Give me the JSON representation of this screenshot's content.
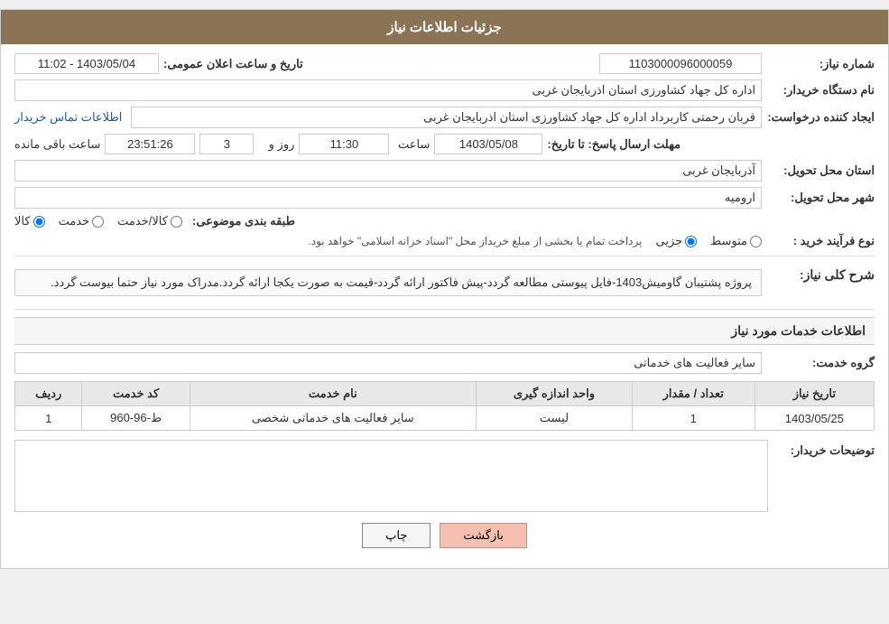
{
  "header": {
    "title": "جزئیات اطلاعات نیاز"
  },
  "fields": {
    "need_number_label": "شماره نیاز:",
    "need_number_value": "1103000096000059",
    "announce_datetime_label": "تاریخ و ساعت اعلان عمومی:",
    "announce_datetime_value": "1403/05/04 - 11:02",
    "buyer_org_label": "نام دستگاه خریدار:",
    "buyer_org_value": "اداره کل جهاد کشاورزی استان اذربایجان غربی",
    "creator_label": "ایجاد کننده درخواست:",
    "creator_value": "قربان  رحمتی  کاربرداد اداره کل جهاد کشاورزی استان اذربایجان غربی",
    "contact_info_link": "اطلاعات تماس خریدار",
    "reply_deadline_label": "مهلت ارسال پاسخ: تا تاریخ:",
    "reply_date_value": "1403/05/08",
    "reply_time_label": "ساعت",
    "reply_time_value": "11:30",
    "reply_days_label": "روز و",
    "reply_days_value": "3",
    "reply_remaining_label": "ساعت باقی مانده",
    "reply_remaining_value": "23:51:26",
    "delivery_province_label": "استان محل تحویل:",
    "delivery_province_value": "آذربایجان غربی",
    "delivery_city_label": "شهر محل تحویل:",
    "delivery_city_value": "ارومیه",
    "category_label": "طبقه بندی موضوعی:",
    "category_options": [
      {
        "label": "کالا",
        "value": "kala"
      },
      {
        "label": "خدمت",
        "value": "khedmat"
      },
      {
        "label": "کالا/خدمت",
        "value": "kala_khedmat"
      }
    ],
    "purchase_type_label": "نوع فرآیند خرید :",
    "purchase_type_options": [
      {
        "label": "جزیی",
        "value": "jozi"
      },
      {
        "label": "متوسط",
        "value": "motavaset"
      }
    ],
    "purchase_type_note": "پرداخت تمام یا بخشی از مبلغ خریداز محل \"اسناد خزانه اسلامی\" خواهد بود.",
    "description_section_title": "شرح کلی نیاز:",
    "description_text": "پروژه پشتیبان گاومیش1403-فایل پیوستی مطالعه گردد-پیش فاکتور ارائه گردد-قیمت به صورت یکجا ارائه گردد.مدراک مورد نیاز حتما بیوست گردد.",
    "services_section_title": "اطلاعات خدمات مورد نیاز",
    "service_group_label": "گروه خدمت:",
    "service_group_value": "سایر فعالیت های خدماتی",
    "table": {
      "headers": [
        "ردیف",
        "کد خدمت",
        "نام خدمت",
        "واحد اندازه گیری",
        "تعداد / مقدار",
        "تاریخ نیاز"
      ],
      "rows": [
        {
          "row_num": "1",
          "service_code": "ط-96-960",
          "service_name": "سایر فعالیت های خدماتی شخصی",
          "unit": "لیست",
          "quantity": "1",
          "need_date": "1403/05/25"
        }
      ]
    },
    "buyer_desc_label": "توضیحات خریدار:",
    "buyer_desc_value": "",
    "btn_print": "چاپ",
    "btn_back": "بازگشت"
  }
}
